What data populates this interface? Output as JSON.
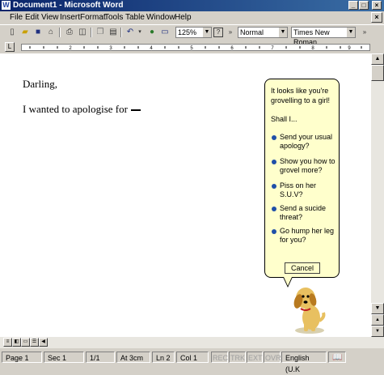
{
  "window": {
    "title": "Document1 - Microsoft Word",
    "app_icon_letter": "W"
  },
  "menu": [
    {
      "id": "file",
      "label": "File"
    },
    {
      "id": "edit",
      "label": "Edit"
    },
    {
      "id": "view",
      "label": "View"
    },
    {
      "id": "insert",
      "label": "Insert"
    },
    {
      "id": "format",
      "label": "Format"
    },
    {
      "id": "tools",
      "label": "Tools"
    },
    {
      "id": "table",
      "label": "Table"
    },
    {
      "id": "window",
      "label": "Window"
    },
    {
      "id": "help",
      "label": "Help"
    }
  ],
  "toolbar": {
    "zoom": "125%",
    "style": "Normal",
    "font": "Times New Roman",
    "icons": [
      "new-doc-icon",
      "open-icon",
      "save-icon",
      "permission-icon",
      "print-icon",
      "print-preview-icon",
      "copy-icon",
      "paste-icon",
      "undo-icon",
      "hyperlink-icon",
      "table-icon",
      "help-icon"
    ]
  },
  "document": {
    "salutation": "Darling,",
    "body_line": "I wanted to apologise for"
  },
  "assistant": {
    "question": "It looks like you're grovelling to a girl!",
    "prompt": "Shall I...",
    "options": [
      "Send your usual apology?",
      "Show you how to grovel more?",
      "Piss on her S.U.V?",
      "Send a sucide threat?",
      "Go hump her leg for you?"
    ],
    "cancel_label": "Cancel",
    "bullet_color": "#1f4fa8",
    "balloon_color": "#ffffcc"
  },
  "status": {
    "page": "Page 1",
    "sec": "Sec 1",
    "pages": "1/1",
    "at": "At 3cm",
    "ln": "Ln 2",
    "col": "Col 1",
    "rec": "REC",
    "trk": "TRK",
    "ext": "EXT",
    "ovr": "OVR",
    "language": "English (U.K"
  }
}
